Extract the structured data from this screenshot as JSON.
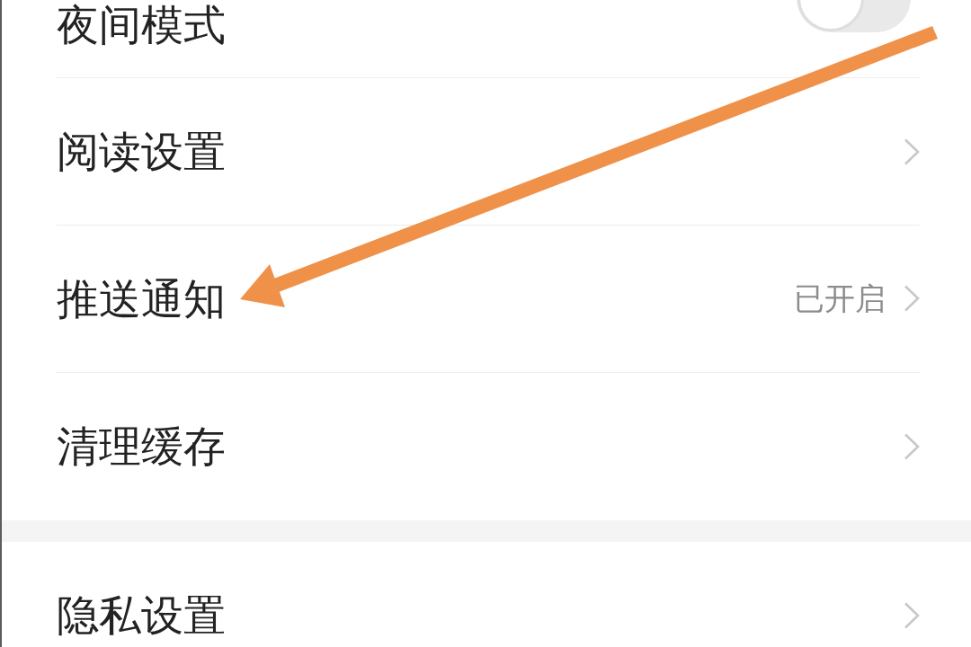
{
  "groups": [
    {
      "items": [
        {
          "label": "夜间模式",
          "kind": "toggle",
          "on": false
        },
        {
          "label": "阅读设置",
          "kind": "link"
        },
        {
          "label": "推送通知",
          "kind": "link",
          "value": "已开启"
        },
        {
          "label": "清理缓存",
          "kind": "link"
        }
      ]
    },
    {
      "items": [
        {
          "label": "隐私设置",
          "kind": "link"
        }
      ]
    }
  ]
}
